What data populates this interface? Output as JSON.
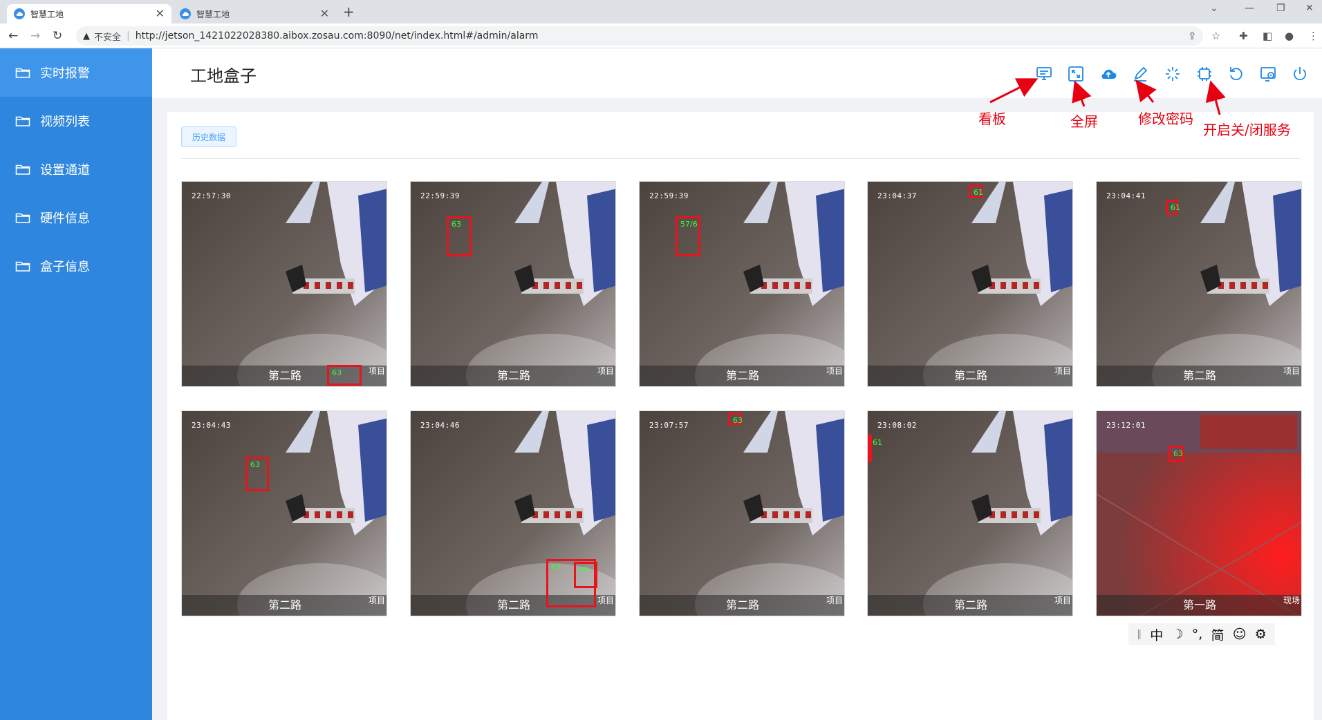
{
  "browser": {
    "tabs": [
      {
        "title": "智慧工地",
        "close": "✕"
      },
      {
        "title": "智慧工地",
        "close": "✕"
      }
    ],
    "new_tab": "+",
    "security_label": "不安全",
    "url": "http://jetson_1421022028380.aibox.zosau.com:8090/net/index.html#/admin/alarm"
  },
  "sidebar": {
    "items": [
      {
        "label": "实时报警"
      },
      {
        "label": "视频列表"
      },
      {
        "label": "设置通道"
      },
      {
        "label": "硬件信息"
      },
      {
        "label": "盒子信息"
      }
    ]
  },
  "header": {
    "title": "工地盒子",
    "icons": [
      "dashboard-icon",
      "fullscreen-icon",
      "upload-cloud-icon",
      "edit-password-icon",
      "loading-icon",
      "chip-icon",
      "restart-icon",
      "settings-monitor-icon",
      "power-icon"
    ]
  },
  "main": {
    "history_button": "历史数据",
    "cards": [
      {
        "time": "22:57:30",
        "channel": "第二路",
        "corner": "项目"
      },
      {
        "time": "22:59:39",
        "channel": "第二路",
        "corner": "项目"
      },
      {
        "time": "22:59:39",
        "channel": "第二路",
        "corner": "项目"
      },
      {
        "time": "23:04:37",
        "channel": "第二路",
        "corner": "项目"
      },
      {
        "time": "23:04:41",
        "channel": "第二路",
        "corner": "项目"
      },
      {
        "time": "23:04:43",
        "channel": "第二路",
        "corner": "项目"
      },
      {
        "time": "23:04:46",
        "channel": "第二路",
        "corner": "项目"
      },
      {
        "time": "23:07:57",
        "channel": "第二路",
        "corner": "项目"
      },
      {
        "time": "23:08:02",
        "channel": "第二路",
        "corner": "项目"
      },
      {
        "time": "23:12:01",
        "channel": "第一路",
        "corner": "现场"
      }
    ],
    "detections": [
      {
        "score": "63"
      },
      {
        "score": "63"
      },
      {
        "score": "57/6"
      },
      {
        "score": "61"
      },
      {
        "score": "61"
      },
      {
        "score": "63"
      },
      {
        "score": "65"
      },
      {
        "score": "63"
      },
      {
        "score": "61"
      },
      {
        "score": "63"
      }
    ]
  },
  "annotations": {
    "dashboard": "看板",
    "fullscreen": "全屏",
    "password": "修改密码",
    "service": "开启关/闭服务"
  },
  "ime_toolbar": {
    "items": [
      "中",
      "☽",
      "°,",
      "简",
      "☺",
      "⚙"
    ]
  },
  "colors": {
    "sidebar": "#2e86de",
    "accent": "#1e88e5",
    "annotation": "#e60012",
    "bbox": "#e8141c"
  }
}
